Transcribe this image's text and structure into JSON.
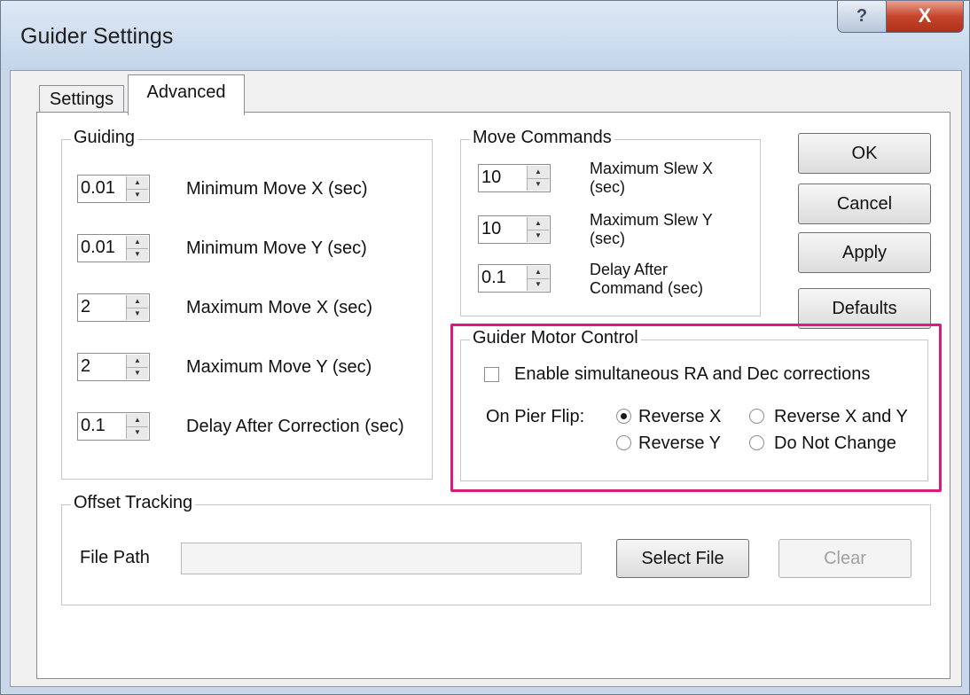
{
  "window": {
    "title": "Guider Settings",
    "help_icon": "?",
    "close_icon": "X"
  },
  "tabs": [
    {
      "label": "Settings",
      "active": false
    },
    {
      "label": "Advanced",
      "active": true
    }
  ],
  "guiding": {
    "title": "Guiding",
    "rows": [
      {
        "value": "0.01",
        "label": "Minimum Move X (sec)"
      },
      {
        "value": "0.01",
        "label": "Minimum Move Y (sec)"
      },
      {
        "value": "2",
        "label": "Maximum Move X (sec)"
      },
      {
        "value": "2",
        "label": "Maximum Move Y (sec)"
      },
      {
        "value": "0.1",
        "label": "Delay After Correction (sec)"
      }
    ]
  },
  "move_commands": {
    "title": "Move Commands",
    "rows": [
      {
        "value": "10",
        "label": "Maximum Slew X (sec)"
      },
      {
        "value": "10",
        "label": "Maximum Slew Y (sec)"
      },
      {
        "value": "0.1",
        "label": "Delay After Command (sec)"
      }
    ]
  },
  "buttons": {
    "ok": "OK",
    "cancel": "Cancel",
    "apply": "Apply",
    "defaults": "Defaults"
  },
  "motor_control": {
    "title": "Guider Motor Control",
    "simultaneous_label": "Enable simultaneous RA and Dec corrections",
    "simultaneous_checked": false,
    "pier_flip_label": "On Pier Flip:",
    "options": {
      "reverse_x": "Reverse X",
      "reverse_x_and_y": "Reverse X and Y",
      "reverse_y": "Reverse Y",
      "do_not_change": "Do Not Change"
    },
    "selected": "reverse_x",
    "highlight_color": "#d81b7c"
  },
  "offset_tracking": {
    "title": "Offset Tracking",
    "file_path_label": "File Path",
    "file_path_value": "",
    "select_file": "Select File",
    "clear": "Clear"
  }
}
